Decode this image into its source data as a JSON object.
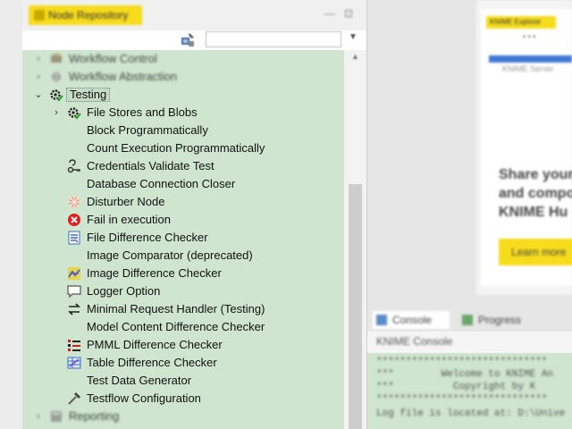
{
  "node_repository": {
    "title": "Node Repository",
    "minimize_glyph": "—",
    "maximize_glyph": "⊡",
    "search": {
      "value": "",
      "placeholder": ""
    },
    "search_dropdown_glyph": "▼",
    "tree_background": "#cfe5cf",
    "tree": [
      {
        "label": "Workflow Control",
        "indent": 0,
        "arrow": "›",
        "icon": "workflow-control-icon",
        "blurred": true
      },
      {
        "label": "Workflow Abstraction",
        "indent": 0,
        "arrow": "›",
        "icon": "workflow-abstraction-icon",
        "blurred": true
      },
      {
        "label": "Testing",
        "indent": 0,
        "arrow": "⌄",
        "icon": "testing-gear-icon",
        "selected": true
      },
      {
        "label": "File Stores and Blobs",
        "indent": 1,
        "arrow": "›",
        "icon": "testing-gear-icon"
      },
      {
        "label": "Block Programmatically",
        "indent": 1,
        "icon": ""
      },
      {
        "label": "Count Execution Programmatically",
        "indent": 1,
        "icon": ""
      },
      {
        "label": "Credentials Validate Test",
        "indent": 1,
        "icon": "credentials-icon"
      },
      {
        "label": "Database Connection Closer",
        "indent": 1,
        "icon": ""
      },
      {
        "label": "Disturber Node",
        "indent": 1,
        "icon": "disturber-icon"
      },
      {
        "label": "Fail in execution",
        "indent": 1,
        "icon": "fail-icon"
      },
      {
        "label": "File Difference Checker",
        "indent": 1,
        "icon": "file-diff-icon"
      },
      {
        "label": "Image Comparator (deprecated)",
        "indent": 1,
        "icon": ""
      },
      {
        "label": "Image Difference Checker",
        "indent": 1,
        "icon": "image-diff-icon"
      },
      {
        "label": "Logger Option",
        "indent": 1,
        "icon": "logger-icon"
      },
      {
        "label": "Minimal Request Handler (Testing)",
        "indent": 1,
        "icon": "request-handler-icon"
      },
      {
        "label": "Model Content Difference Checker",
        "indent": 1,
        "icon": ""
      },
      {
        "label": "PMML Difference Checker",
        "indent": 1,
        "icon": "pmml-diff-icon"
      },
      {
        "label": "Table Difference Checker",
        "indent": 1,
        "icon": "table-diff-icon"
      },
      {
        "label": "Test Data Generator",
        "indent": 1,
        "icon": ""
      },
      {
        "label": "Testflow Configuration",
        "indent": 1,
        "icon": "hammer-icon"
      },
      {
        "label": "Reporting",
        "indent": 0,
        "arrow": "›",
        "icon": "reporting-icon",
        "blurred": true
      }
    ]
  },
  "welcome": {
    "tab_label": "KNIME Explorer",
    "dots": "• • •",
    "sub_label": "KNIME Server",
    "promo_lines": [
      "Share your",
      "and compo",
      "KNIME Hu"
    ],
    "button_label": "Learn more",
    "accent_color": "#f7dc1c"
  },
  "console": {
    "tab_console": "Console",
    "tab_progress": "Progress",
    "subtitle": "KNIME Console",
    "lines": [
      "*****************************",
      "***        Welcome to KNIME An",
      "***          Copyright by K",
      "*****************************",
      "Log file is located at: D:\\Unive"
    ]
  }
}
